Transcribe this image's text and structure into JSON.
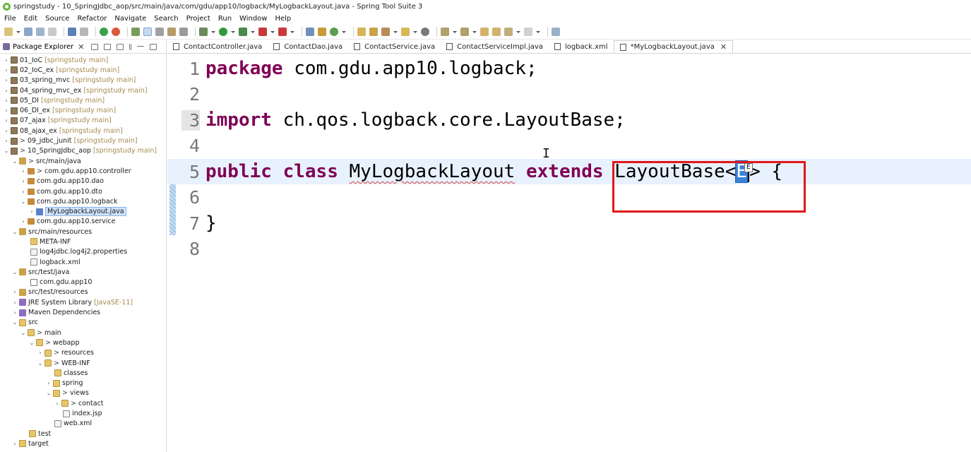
{
  "window": {
    "title": "springstudy - 10_SpringJdbc_aop/src/main/java/com/gdu/app10/logback/MyLogbackLayout.java - Spring Tool Suite 3"
  },
  "menu": [
    "File",
    "Edit",
    "Source",
    "Refactor",
    "Navigate",
    "Search",
    "Project",
    "Run",
    "Window",
    "Help"
  ],
  "package_explorer": {
    "title": "Package Explorer",
    "close": "✕",
    "items": [
      {
        "label": "01_IoC",
        "suffix": "[springstudy main]"
      },
      {
        "label": "02_IoC_ex",
        "suffix": "[springstudy main]"
      },
      {
        "label": "03_spring_mvc",
        "suffix": "[springstudy main]"
      },
      {
        "label": "04_spring_mvc_ex",
        "suffix": "[springstudy main]"
      },
      {
        "label": "05_DI",
        "suffix": "[springstudy main]"
      },
      {
        "label": "06_DI_ex",
        "suffix": "[springstudy main]"
      },
      {
        "label": "07_ajax",
        "suffix": "[springstudy main]"
      },
      {
        "label": "08_ajax_ex",
        "suffix": "[springstudy main]"
      },
      {
        "prefix": ">",
        "label": "09_jdbc_junit",
        "suffix": "[springstudy main]"
      },
      {
        "prefix": ">",
        "label": "10_SpringJdbc_aop",
        "suffix": "[springstudy main]"
      },
      {
        "prefix": ">",
        "label": "src/main/java"
      },
      {
        "prefix": ">",
        "label": "com.gdu.app10.controller"
      },
      {
        "label": "com.gdu.app10.dao"
      },
      {
        "label": "com.gdu.app10.dto"
      },
      {
        "label": "com.gdu.app10.logback"
      },
      {
        "prefix": ">",
        "label": "MyLogbackLayout.java"
      },
      {
        "label": "com.gdu.app10.service"
      },
      {
        "label": "src/main/resources"
      },
      {
        "label": "META-INF"
      },
      {
        "label": "log4jdbc.log4j2.properties"
      },
      {
        "label": "logback.xml"
      },
      {
        "label": "src/test/java"
      },
      {
        "label": "com.gdu.app10"
      },
      {
        "label": "src/test/resources"
      },
      {
        "label": "JRE System Library",
        "suffix": "[JavaSE-11]"
      },
      {
        "label": "Maven Dependencies"
      },
      {
        "label": "src"
      },
      {
        "prefix": ">",
        "label": "main"
      },
      {
        "prefix": ">",
        "label": "webapp"
      },
      {
        "prefix": ">",
        "label": "resources"
      },
      {
        "prefix": ">",
        "label": "WEB-INF"
      },
      {
        "label": "classes"
      },
      {
        "label": "spring"
      },
      {
        "prefix": ">",
        "label": "views"
      },
      {
        "prefix": ">",
        "label": "contact"
      },
      {
        "label": "index.jsp"
      },
      {
        "label": "web.xml"
      },
      {
        "label": "test"
      },
      {
        "label": "target"
      }
    ]
  },
  "editor": {
    "tabs": [
      {
        "label": "ContactController.java"
      },
      {
        "label": "ContactDao.java"
      },
      {
        "label": "ContactService.java"
      },
      {
        "label": "ContactServiceImpl.java"
      },
      {
        "label": "logback.xml"
      },
      {
        "label": "*MyLogbackLayout.java",
        "close": "✕"
      }
    ],
    "line_numbers": [
      "1",
      "2",
      "3",
      "4",
      "5",
      "6",
      "7",
      "8"
    ],
    "code": {
      "l1_kw": "package",
      "l1_rest": " com.gdu.app10.logback;",
      "l3_kw": "import",
      "l3_rest": " ch.qos.logback.core.LayoutBase;",
      "l5_kw1": "public",
      "l5_kw2": "class",
      "l5_name": "MyLogbackLayout",
      "l5_kw3": "extends",
      "l5_base": "LayoutBase<",
      "l5_tparam": "E",
      "l5_end": "> {",
      "l7": "}"
    },
    "hover_tip": "E"
  }
}
